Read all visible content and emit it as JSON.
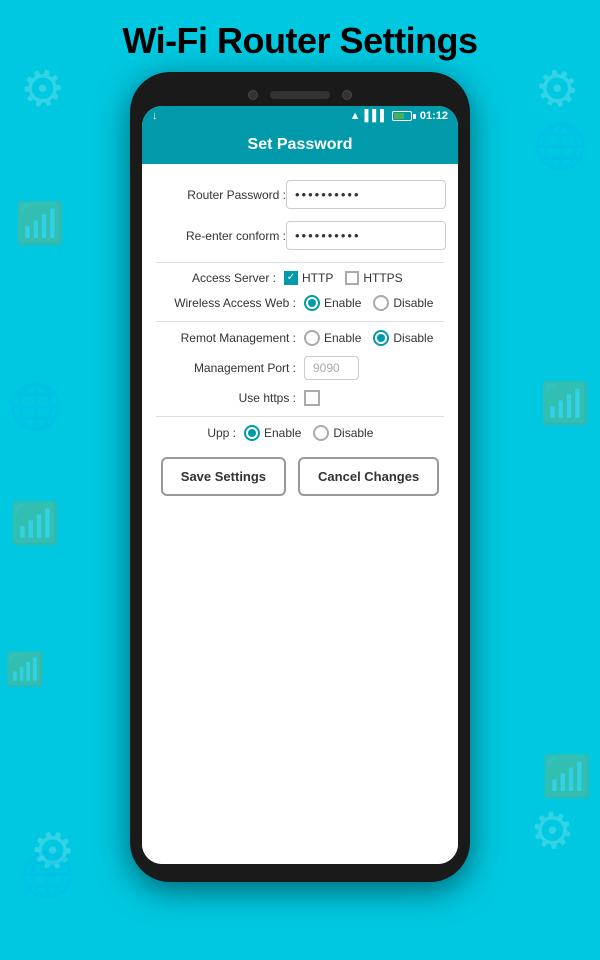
{
  "page": {
    "title": "Wi-Fi Router Settings",
    "background_color": "#00c8e0"
  },
  "status_bar": {
    "time": "01:12",
    "signal_icon": "📶",
    "wifi_icon": "📡"
  },
  "app_bar": {
    "title": "Set Password"
  },
  "form": {
    "router_password_label": "Router Password :",
    "router_password_value": "**********",
    "reenter_label": "Re-enter conform :",
    "reenter_value": "**********",
    "access_server_label": "Access Server :",
    "http_label": "HTTP",
    "https_label": "HTTPS",
    "wireless_access_label": "Wireless Access Web :",
    "enable_label": "Enable",
    "disable_label": "Disable",
    "remote_management_label": "Remot Management :",
    "management_port_label": "Management Port :",
    "management_port_value": "9090",
    "use_https_label": "Use https :",
    "upp_label": "Upp :"
  },
  "buttons": {
    "save_label": "Save  Settings",
    "cancel_label": "Cancel Changes"
  }
}
